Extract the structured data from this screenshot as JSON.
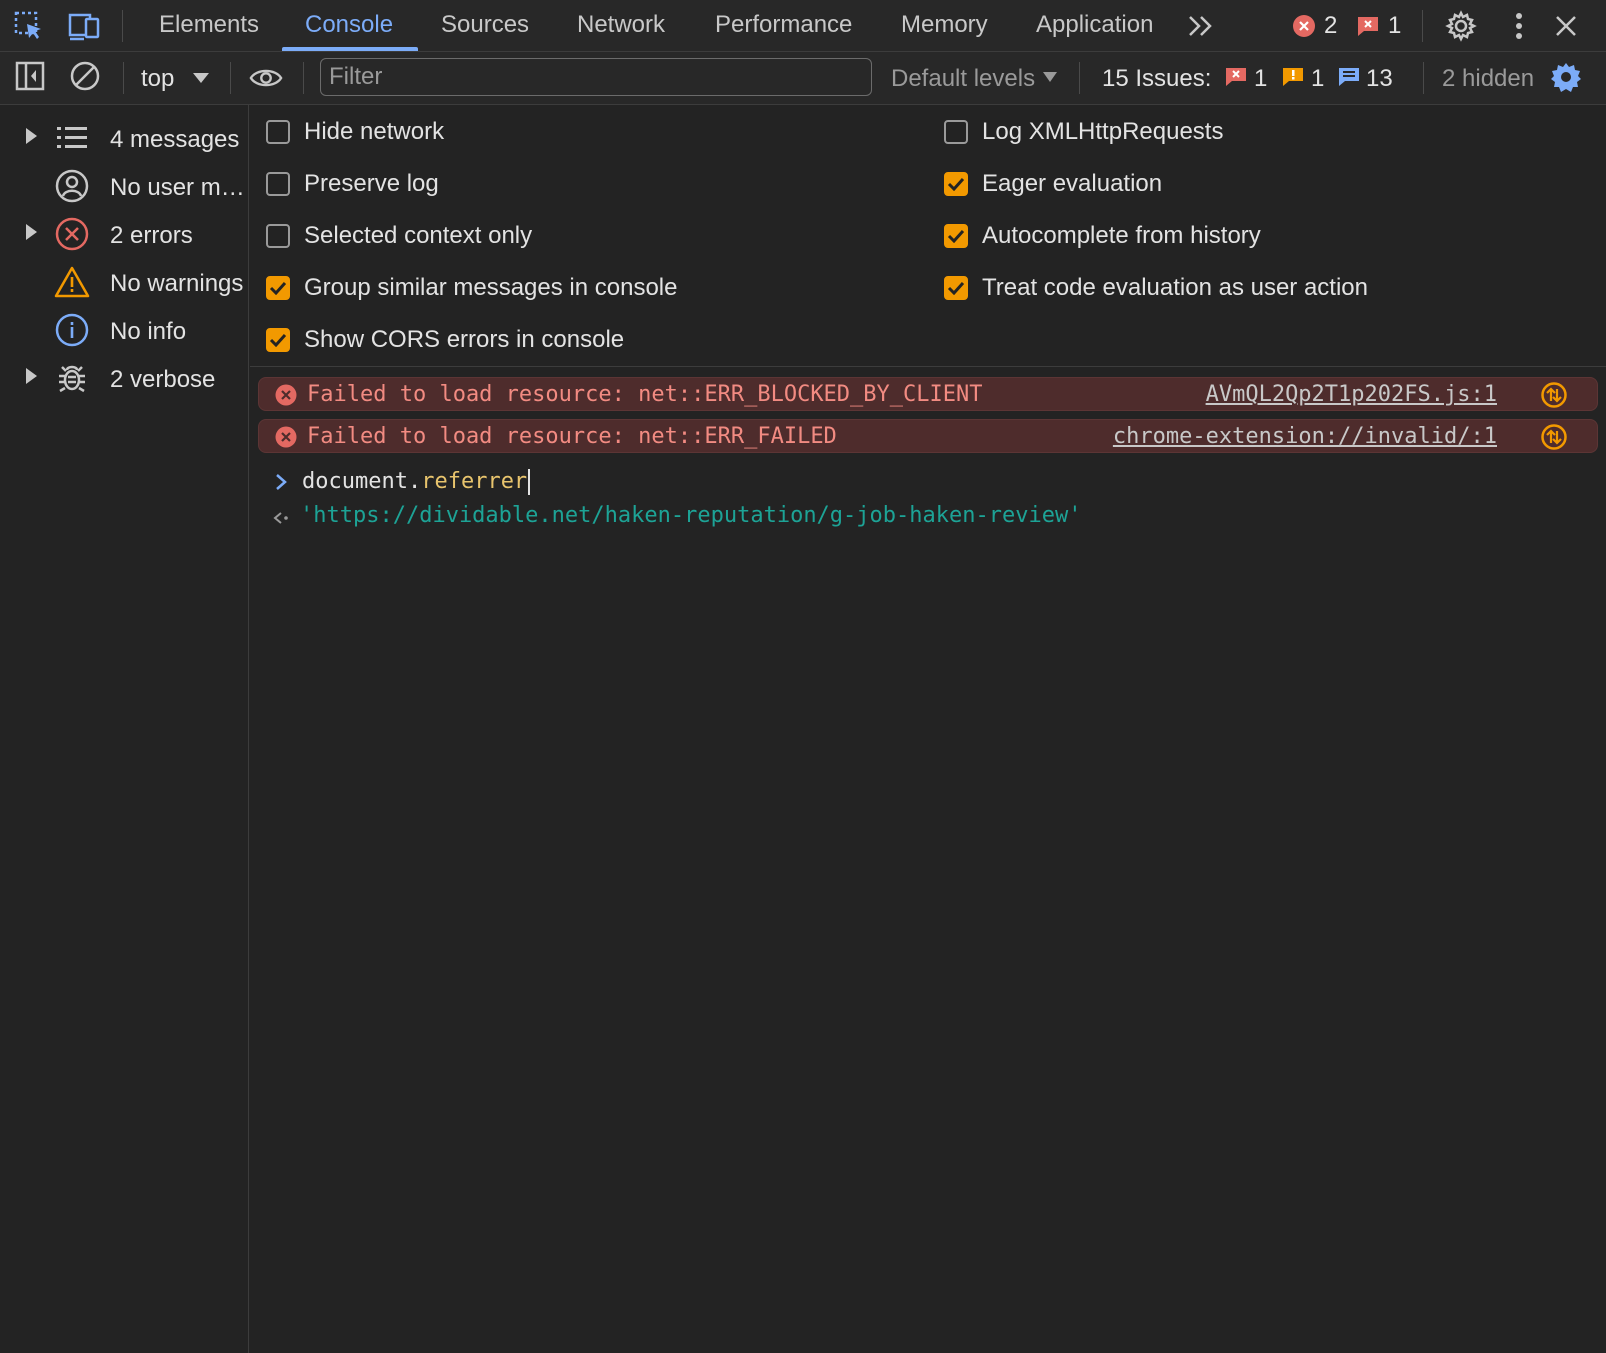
{
  "tabbar": {
    "tabs": [
      "Elements",
      "Console",
      "Sources",
      "Network",
      "Performance",
      "Memory",
      "Application"
    ],
    "active_tab": "Console",
    "error_count": "2",
    "issue_count": "1"
  },
  "toolbar": {
    "context": "top",
    "filter_placeholder": "Filter",
    "levels": "Default levels",
    "issues_label": "15 Issues:",
    "issues_error": "1",
    "issues_warning": "1",
    "issues_info": "13",
    "hidden": "2 hidden"
  },
  "sidebar": {
    "items": [
      {
        "label": "4 messages",
        "icon": "list-icon",
        "expandable": true
      },
      {
        "label": "No user messages",
        "icon": "user-icon",
        "expandable": false
      },
      {
        "label": "2 errors",
        "icon": "error-icon",
        "expandable": true
      },
      {
        "label": "No warnings",
        "icon": "warning-icon",
        "expandable": false
      },
      {
        "label": "No info",
        "icon": "info-icon",
        "expandable": false
      },
      {
        "label": "2 verbose",
        "icon": "bug-icon",
        "expandable": true
      }
    ]
  },
  "settings": {
    "left": [
      {
        "label": "Hide network",
        "checked": false
      },
      {
        "label": "Preserve log",
        "checked": false
      },
      {
        "label": "Selected context only",
        "checked": false
      },
      {
        "label": "Group similar messages in console",
        "checked": true
      },
      {
        "label": "Show CORS errors in console",
        "checked": true
      }
    ],
    "right": [
      {
        "label": "Log XMLHttpRequests",
        "checked": false
      },
      {
        "label": "Eager evaluation",
        "checked": true
      },
      {
        "label": "Autocomplete from history",
        "checked": true
      },
      {
        "label": "Treat code evaluation as user action",
        "checked": true
      }
    ]
  },
  "console": {
    "messages": [
      {
        "text": "Failed to load resource: net::ERR_BLOCKED_BY_CLIENT",
        "source": "AVmQL2Qp2T1p202FS.js:1"
      },
      {
        "text": "Failed to load resource: net::ERR_FAILED",
        "source": "chrome-extension://invalid/:1"
      }
    ],
    "input_object": "document.",
    "input_property": "referrer",
    "result": "'https://dividable.net/haken-reputation/g-job-haken-review'"
  },
  "colors": {
    "accent": "#7cacf8",
    "checkbox": "#f29900",
    "error_text": "#f28b82",
    "error_bg": "#4e2c2c",
    "string_result": "#1da396",
    "property": "#e8c46d"
  }
}
